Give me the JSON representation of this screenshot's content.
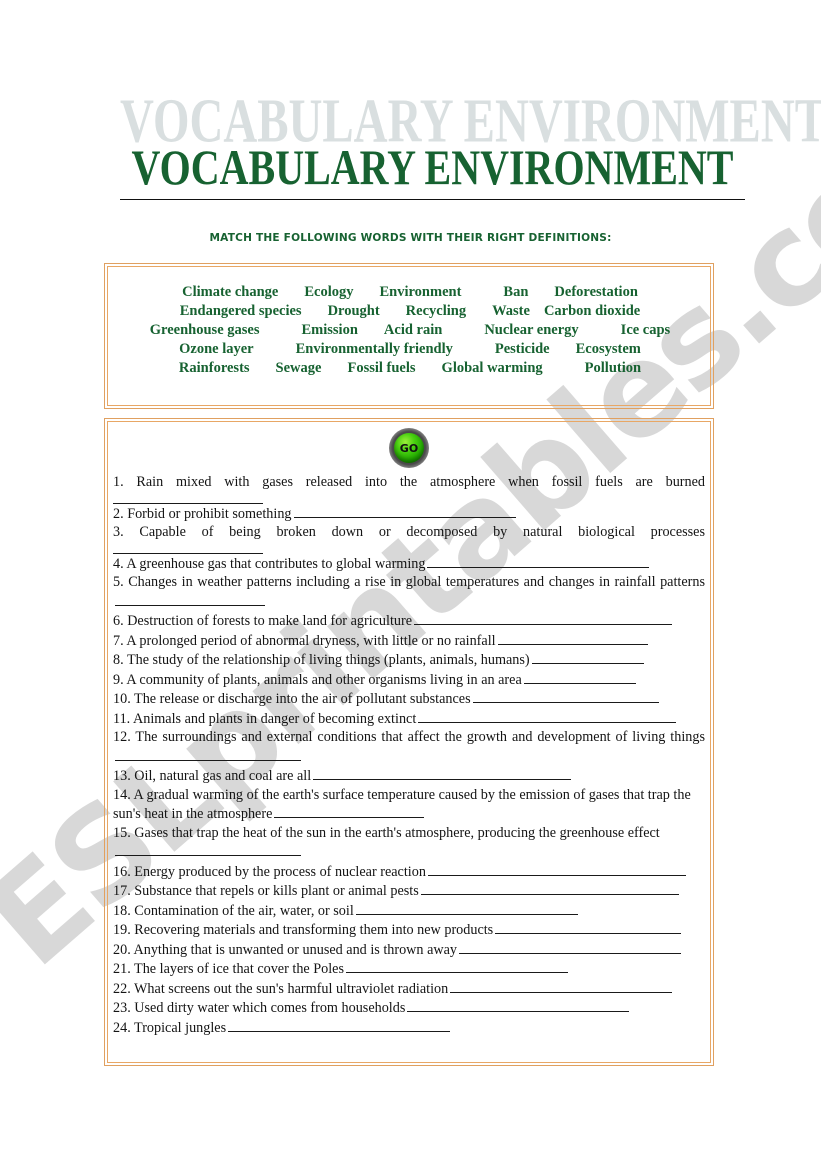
{
  "document": {
    "title_ghost": "VOCABULARY ENVIRONMENT",
    "title": "VOCABULARY ENVIRONMENT",
    "subtitle": "MATCH THE FOLLOWING WORDS WITH THEIR RIGHT DEFINITIONS:",
    "watermark": "ESLprintables.com",
    "colors": {
      "title_green": "#176231",
      "ghost_gray": "#d9dfe0",
      "box_border_orange": "#e8a765",
      "go_green": "#20a800",
      "text_black": "#141414"
    }
  },
  "go_button": {
    "label": "GO"
  },
  "word_bank": {
    "rows": [
      [
        "Climate change",
        "Ecology",
        "Environment",
        "Ban",
        "Deforestation"
      ],
      [
        "Endangered species",
        "Drought",
        "Recycling",
        "Waste",
        "Carbon dioxide"
      ],
      [
        "Greenhouse gases",
        "Emission",
        "Acid rain",
        "Nuclear energy",
        "Ice caps"
      ],
      [
        "Ozone layer",
        "Environmentally friendly",
        "Pesticide",
        "Ecosystem"
      ],
      [
        "Rainforests",
        "Sewage",
        "Fossil fuels",
        "Global warming",
        "Pollution"
      ]
    ]
  },
  "definitions": [
    {
      "number": "1.",
      "text": "Rain mixed with gases released into the atmosphere when fossil fuels are burned",
      "blank": "own",
      "justify": true
    },
    {
      "number": "2.",
      "text": "Forbid or prohibit something",
      "blank": "xl",
      "justify": false
    },
    {
      "number": "3.",
      "text": "Capable of being broken down or decomposed by natural biological processes",
      "blank": "own",
      "justify": true
    },
    {
      "number": "4.",
      "text": "A greenhouse gas that contributes to global warming",
      "blank": "xl",
      "justify": false
    },
    {
      "number": "5.",
      "text": "Changes in weather patterns including a rise in global temperatures and changes in rainfall patterns",
      "blank": "md",
      "justify": true
    },
    {
      "number": "6.",
      "text": "Destruction of forests to make land for agriculture",
      "blank": "xxl",
      "justify": false
    },
    {
      "number": "7.",
      "text": "A prolonged period of abnormal dryness, with little or no rainfall",
      "blank": "md",
      "justify": false
    },
    {
      "number": "8.",
      "text": "The study of the relationship of living things (plants, animals, humans)",
      "blank": "sm",
      "justify": false
    },
    {
      "number": "9.",
      "text": "A community of plants, animals and other organisms living in an area",
      "blank": "sm",
      "justify": false
    },
    {
      "number": "10.",
      "text": "The release or discharge into the air of pollutant substances",
      "blank": "lg",
      "justify": false
    },
    {
      "number": "11.",
      "text": "Animals and plants in danger of becoming extinct",
      "blank": "xxl",
      "justify": false
    },
    {
      "number": "12.",
      "text": "The  surroundings and external conditions that affect the growth and  development of living things",
      "blank": "lg",
      "justify": true
    },
    {
      "number": "13.",
      "text": "Oil, natural gas and coal are all",
      "blank": "xxl",
      "justify": false
    },
    {
      "number": "14.",
      "text": "A gradual warming of the earth's surface temperature caused by the emission of gases that trap the sun's heat in the atmosphere",
      "blank": "md",
      "justify": false
    },
    {
      "number": "15.",
      "text": "Gases that trap the heat of the sun in the earth's atmosphere, producing the greenhouse effect",
      "blank": "lg",
      "justify": false
    },
    {
      "number": "16.",
      "text": "Energy produced by the process of nuclear reaction",
      "blank": "xxl",
      "justify": false
    },
    {
      "number": "17.",
      "text": "Substance that repels or kills plant or animal pests",
      "blank": "xxl",
      "justify": false
    },
    {
      "number": "18.",
      "text": "Contamination of the air, water, or soil",
      "blank": "xl",
      "justify": false
    },
    {
      "number": "19.",
      "text": "Recovering materials and transforming them into new products",
      "blank": "lg",
      "justify": false
    },
    {
      "number": "20.",
      "text": "Anything that is unwanted or unused and is thrown away",
      "blank": "xl",
      "justify": false
    },
    {
      "number": "21.",
      "text": "The layers of ice that cover the Poles",
      "blank": "xl",
      "justify": false
    },
    {
      "number": "22.",
      "text": "What screens out the sun's harmful ultraviolet radiation",
      "blank": "xl",
      "justify": false
    },
    {
      "number": "23.",
      "text": "Used dirty water which comes from households",
      "blank": "xl",
      "justify": false
    },
    {
      "number": "24.",
      "text": "Tropical jungles",
      "blank": "xl",
      "justify": false
    }
  ]
}
